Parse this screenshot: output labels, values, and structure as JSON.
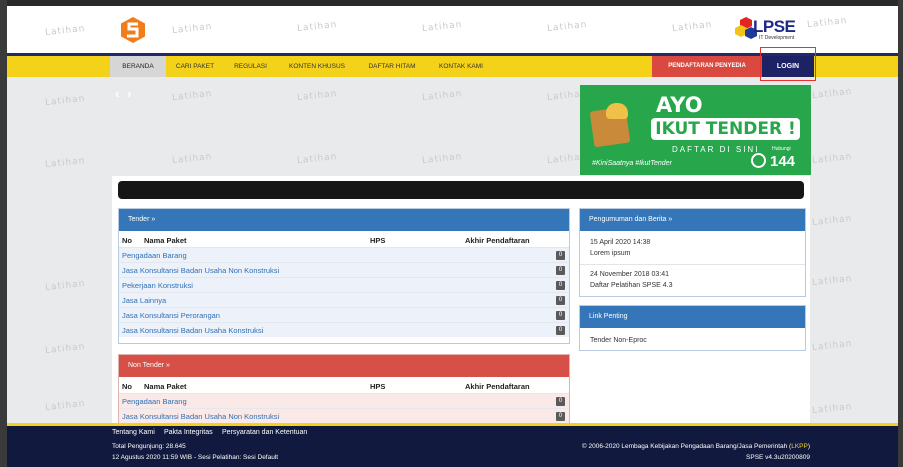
{
  "watermark": "Latihan",
  "header": {
    "lpse_logo_text": "LPSE",
    "lpse_logo_sub": "IT Development"
  },
  "nav": {
    "items": [
      "BERANDA",
      "CARI PAKET",
      "REGULASI",
      "KONTEN KHUSUS",
      "DAFTAR HITAM",
      "KONTAK KAMI"
    ],
    "register": "PENDAFTARAN PENYEDIA",
    "login": "LOGIN"
  },
  "carousel": {
    "prev": "‹",
    "next": "›"
  },
  "banner": {
    "ayo": "AYO",
    "ikut": "IKUT TENDER !",
    "daftar": "DAFTAR DI SINI",
    "tags": "#KiniSaatnya #IkutTender",
    "hubungi": "Hubungi",
    "number": "144"
  },
  "tender": {
    "title": "Tender »",
    "columns": [
      "No",
      "Nama Paket",
      "HPS",
      "Akhir Pendaftaran"
    ],
    "rows": [
      {
        "name": "Pengadaan Barang",
        "count": "0"
      },
      {
        "name": "Jasa Konsultansi Badan Usaha Non Konstruksi",
        "count": "0"
      },
      {
        "name": "Pekerjaan Konstruksi",
        "count": "0"
      },
      {
        "name": "Jasa Lainnya",
        "count": "0"
      },
      {
        "name": "Jasa Konsultansi Perorangan",
        "count": "0"
      },
      {
        "name": "Jasa Konsultansi Badan Usaha Konstruksi",
        "count": "0"
      }
    ]
  },
  "non_tender": {
    "title": "Non Tender »",
    "columns": [
      "No",
      "Nama Paket",
      "HPS",
      "Akhir Pendaftaran"
    ],
    "rows": [
      {
        "name": "Pengadaan Barang",
        "count": "0"
      },
      {
        "name": "Jasa Konsultansi Badan Usaha Non Konstruksi",
        "count": "0"
      }
    ]
  },
  "news": {
    "title": "Pengumuman dan Berita »",
    "items": [
      {
        "date": "15 April 2020 14:38",
        "text": "Lorem ipsum"
      },
      {
        "date": "24 November 2018 03:41",
        "text": "Daftar Pelatihan SPSE 4.3"
      }
    ]
  },
  "links": {
    "title": "Link Penting",
    "items": [
      "Tender Non-Eproc"
    ]
  },
  "footer": {
    "links": [
      "Tentang Kami",
      "Pakta Integritas",
      "Persyaratan dan Ketentuan"
    ],
    "visitors": "Total Pengunjung: 28.645",
    "session": "12 Agustus 2020 11:59 WIB - Sesi Pelatihan: Sesi Default",
    "copyright": "© 2006-2020 Lembaga Kebijakan Pengadaan Barang/Jasa Pemerintah (",
    "copyright_lkpp": "LKPP",
    "copyright_end": ")",
    "version": "SPSE v4.3u20200809"
  },
  "colors": {
    "nav_yellow": "#f4d21a",
    "navy": "#1c2263",
    "panel_blue": "#3576b8",
    "panel_red": "#d65048",
    "banner_green": "#27a64c"
  }
}
